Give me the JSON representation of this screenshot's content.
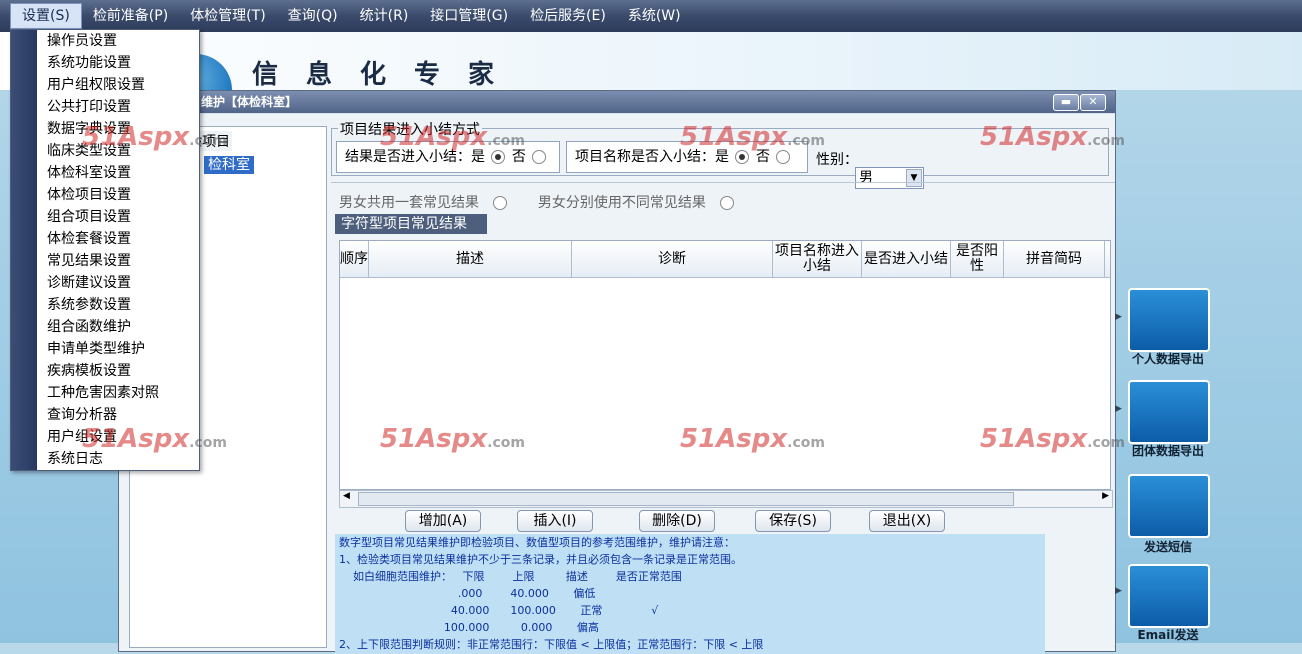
{
  "menubar": [
    "设置(S)",
    "检前准备(P)",
    "体检管理(T)",
    "查询(Q)",
    "统计(R)",
    "接口管理(G)",
    "检后服务(E)",
    "系统(W)"
  ],
  "banner": {
    "title": "信息化专家"
  },
  "window": {
    "title": "维护【体检科室】",
    "minimize": "▬",
    "close": "✕",
    "left_legend": "验项目",
    "tree_selected": "检科室",
    "group_legend": "项目结果进入小结方式",
    "opt1_label": "结果是否进入小结：是",
    "opt1_no": "否",
    "opt2_label": "项目名称是否入小结：是",
    "opt2_no": "否",
    "gender_label": "性别：",
    "gender_value": "男",
    "shared_label": "男女共用一套常见结果",
    "separate_label": "男女分别使用不同常见结果",
    "tab_label": "字符型项目常见结果",
    "columns": [
      "顺序",
      "描述",
      "诊断",
      "项目名称进入小结",
      "是否进入小结",
      "是否阳性",
      "拼音简码"
    ],
    "buttons": [
      "增加(A)",
      "插入(I)",
      "删除(D)",
      "保存(S)",
      "退出(X)"
    ],
    "notes": [
      "数字型项目常见结果维护即检验项目、数值型项目的参考范围维护，维护请注意：",
      "1、检验类项目常见结果维护不少于三条记录，并且必须包含一条记录是正常范围。",
      "    如白细胞范围维护：   下限        上限         描述        是否正常范围",
      "                                  .000        40.000       偏低",
      "                                40.000      100.000       正常              √",
      "                              100.000         0.000       偏高",
      "2、上下限范围判断规则：非正常范围行：下限值 < 上限值；正常范围行：下限 < 上限"
    ]
  },
  "dropdown": [
    "操作员设置",
    "系统功能设置",
    "用户组权限设置",
    "公共打印设置",
    "数据字典设置",
    "临床类型设置",
    "体检科室设置",
    "体检项目设置",
    "组合项目设置",
    "体检套餐设置",
    "常见结果设置",
    "诊断建议设置",
    "系统参数设置",
    "组合函数维护",
    "申请单类型维护",
    "疾病模板设置",
    "工种危害因素对照",
    "查询分析器",
    "用户组设置",
    "系统日志"
  ],
  "right_panel": [
    "个人数据导出",
    "团体数据导出",
    "发送短信",
    "Email发送"
  ],
  "watermark": {
    "brand": "51Aspx",
    "suffix": ".com"
  }
}
